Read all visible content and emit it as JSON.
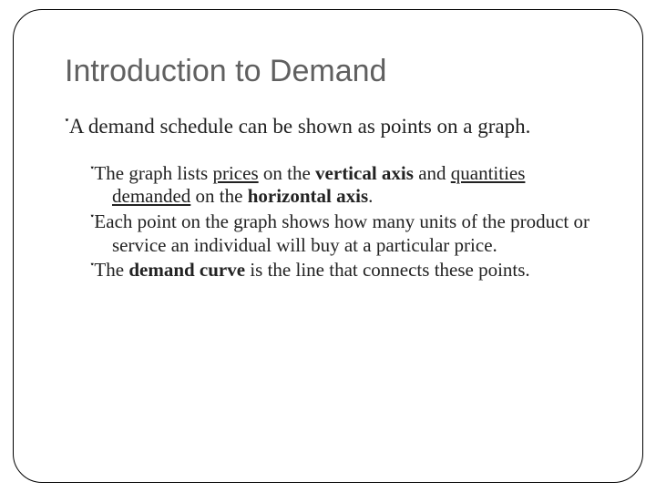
{
  "title": "Introduction to Demand",
  "bullet": "་",
  "l1": {
    "text": "A demand schedule can be shown as points on a graph."
  },
  "l2a": {
    "pre": "The graph lists ",
    "u1": "prices",
    "mid1": " on the ",
    "b1": "vertical axis",
    "mid2": " and ",
    "u2": "quantities demanded",
    "mid3": " on the ",
    "b2": "horizontal axis",
    "end": "."
  },
  "l2b": {
    "text": "Each point on the graph shows how many units of the product or service an individual will buy at a particular price."
  },
  "l2c": {
    "pre": "The ",
    "b1": "demand curve",
    "end": " is the line that connects these points."
  }
}
